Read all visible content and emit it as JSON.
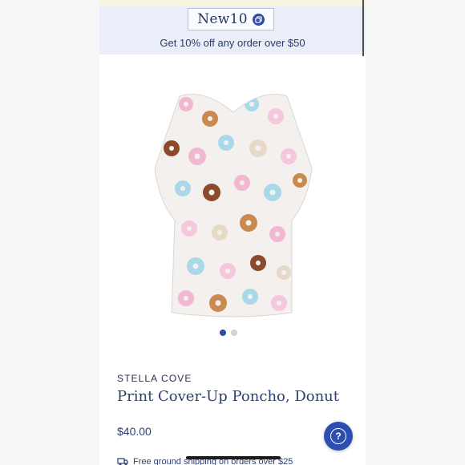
{
  "promo": {
    "code": "New10",
    "copy_icon": "copy-icon",
    "text": "Get 10% off any order over $50"
  },
  "gallery": {
    "image_alt": "Print Cover-Up Poncho, Donut",
    "image_count": 2,
    "active_index": 1
  },
  "product": {
    "brand": "STELLA COVE",
    "title": "Print Cover-Up Poncho, Donut",
    "price": "$40.00"
  },
  "help": {
    "label": "?"
  },
  "shipping": {
    "text": "Free ground shipping on orders over $25",
    "icon": "truck-icon"
  },
  "colors": {
    "accent": "#2b4eb0",
    "banner_bg": "#e9eef8",
    "text_navy": "#2a3f74"
  }
}
